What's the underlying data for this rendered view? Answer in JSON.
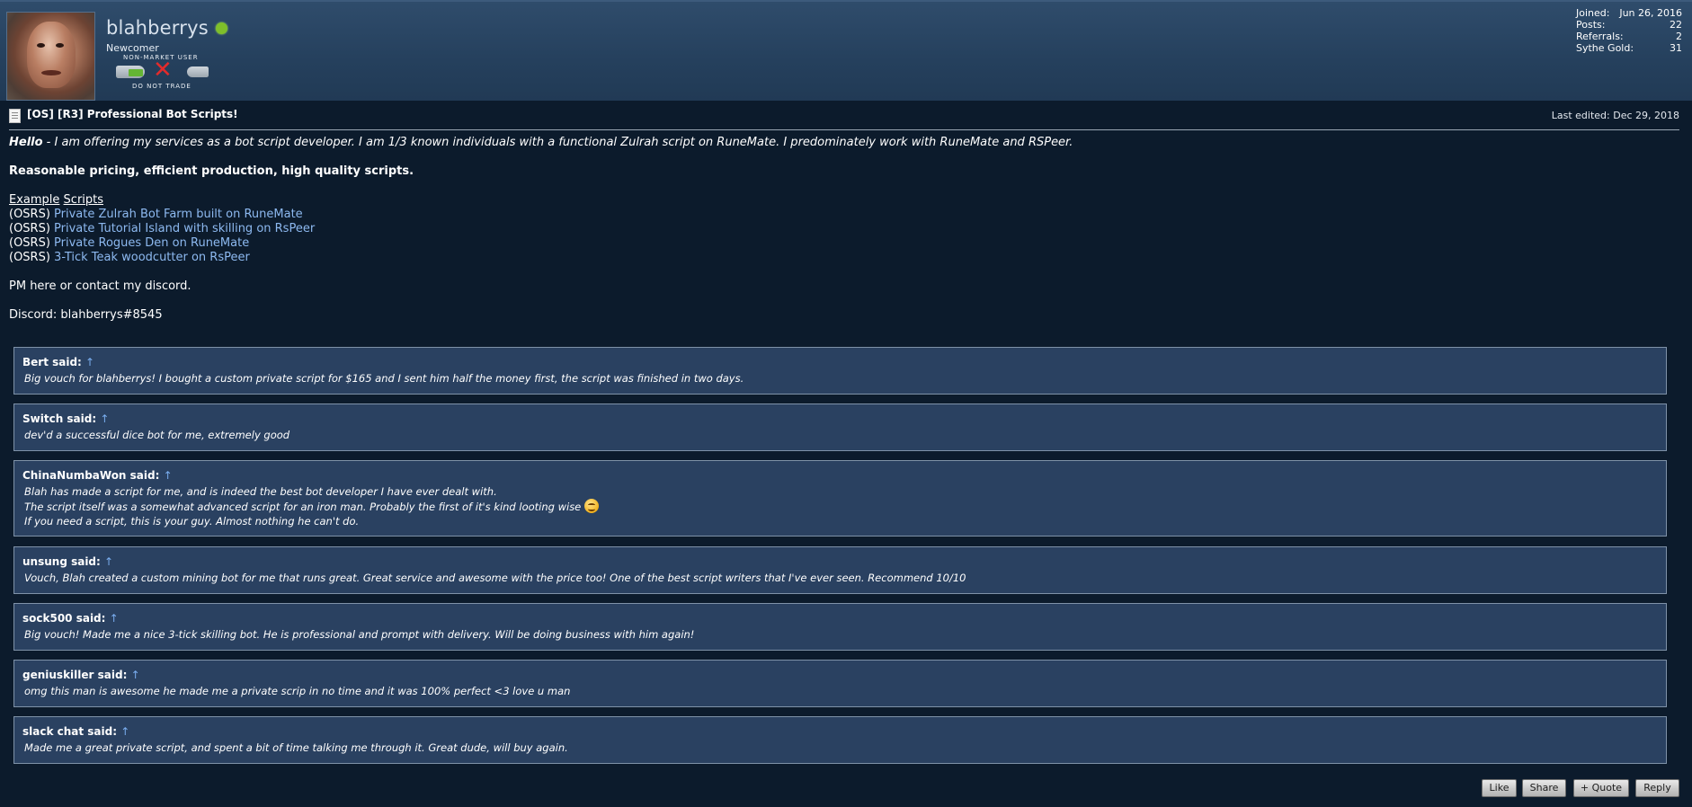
{
  "user": {
    "username": "blahberrys",
    "rank": "Newcomer",
    "badge_top": "NON-MARKET USER",
    "badge_bottom": "DO NOT TRADE",
    "online_color": "#7fbf2a",
    "stats": [
      {
        "label": "Joined:",
        "value": "Jun 26, 2016"
      },
      {
        "label": "Posts:",
        "value": "22"
      },
      {
        "label": "Referrals:",
        "value": "2"
      },
      {
        "label": "Sythe Gold:",
        "value": "31"
      }
    ]
  },
  "post": {
    "title": "[OS] [R3] Professional Bot Scripts!",
    "last_edited": "Last edited: Dec 29, 2018",
    "hello": "Hello",
    "intro": " - I am offering my services as a bot script developer. I am 1/3 known individuals with a functional Zulrah script on RuneMate. I predominately work with RuneMate and RSPeer.",
    "tagline": "Reasonable pricing, efficient production, high quality scripts.",
    "examples_word1": "Example",
    "examples_word2": "Scripts",
    "examples": [
      {
        "prefix": "(OSRS) ",
        "link": "Private Zulrah Bot Farm built on RuneMate"
      },
      {
        "prefix": "(OSRS) ",
        "link": "Private Tutorial Island with skilling on RsPeer"
      },
      {
        "prefix": "(OSRS) ",
        "link": "Private Rogues Den on RuneMate"
      },
      {
        "prefix": "(OSRS) ",
        "link": "3-Tick Teak woodcutter on RsPeer"
      }
    ],
    "contact": "PM here or contact my discord.",
    "discord": "Discord: blahberrys#8545"
  },
  "quotes": [
    {
      "author": "Bert said:",
      "lines": [
        "Big vouch for blahberrys! I bought a custom private script for $165 and I sent him half the money first, the script was finished in two days."
      ]
    },
    {
      "author": "Switch said:",
      "lines": [
        "dev'd a successful dice bot for me, extremely good"
      ]
    },
    {
      "author": "ChinaNumbaWon said:",
      "lines": [
        "Blah has made a script for me, and is indeed the best bot developer I have ever dealt with.",
        "The script itself was a somewhat advanced script for an iron man. Probably the first of it's kind looting wise",
        "If you need a script, this is your guy. Almost nothing he can't do."
      ]
    },
    {
      "author": "unsung said:",
      "lines": [
        "Vouch, Blah created a custom mining bot for me that runs great. Great service and awesome with the price too! One of the best script writers that I've ever seen. Recommend 10/10"
      ]
    },
    {
      "author": "sock500 said:",
      "lines": [
        "Big vouch! Made me a nice 3-tick skilling bot. He is professional and prompt with delivery. Will be doing business with him again!"
      ]
    },
    {
      "author": "geniuskiller said:",
      "lines": [
        "omg this man is awesome he made me a private scrip in no time and it was 100% perfect <3 love u man"
      ]
    },
    {
      "author": "slack chat said:",
      "lines": [
        "Made me a great private script, and spent a bit of time talking me through it. Great dude, will buy again."
      ]
    }
  ],
  "quote_arrow": "↑",
  "actions": {
    "like": "Like",
    "share": "Share",
    "quote": "+ Quote",
    "reply": "Reply"
  }
}
